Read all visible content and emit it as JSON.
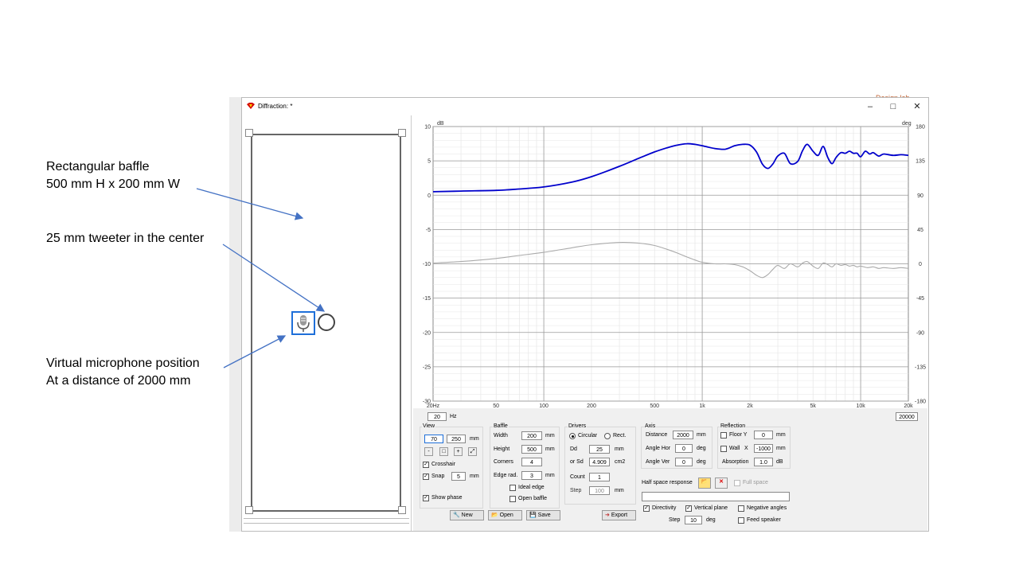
{
  "annotations": {
    "baffle_line1": "Rectangular baffle",
    "baffle_line2": "500 mm H x 200 mm W",
    "tweeter": "25 mm tweeter in the center",
    "mic_line1": "Virtual microphone position",
    "mic_line2": "At a distance of 2000 mm"
  },
  "window": {
    "title": "Diffraction: *",
    "minimize": "–",
    "maximize": "□",
    "close": "✕",
    "peek_text": "Design lab"
  },
  "chart_data": {
    "type": "line",
    "x_scale": "log",
    "xlim": [
      20,
      20000
    ],
    "ylim": [
      -30,
      10
    ],
    "y2lim": [
      -180,
      180
    ],
    "ylabel": "dB",
    "y2label": "deg",
    "x_ticks": [
      {
        "v": 20,
        "label": "20Hz"
      },
      {
        "v": 50,
        "label": "50"
      },
      {
        "v": 100,
        "label": "100"
      },
      {
        "v": 200,
        "label": "200"
      },
      {
        "v": 500,
        "label": "500"
      },
      {
        "v": 1000,
        "label": "1k"
      },
      {
        "v": 2000,
        "label": "2k"
      },
      {
        "v": 5000,
        "label": "5k"
      },
      {
        "v": 10000,
        "label": "10k"
      },
      {
        "v": 20000,
        "label": "20k"
      }
    ],
    "y_ticks": [
      10,
      5,
      0,
      -5,
      -10,
      -15,
      -20,
      -25,
      -30
    ],
    "y2_ticks": [
      180,
      135,
      90,
      45,
      0,
      -45,
      -90,
      -135,
      -180
    ],
    "grid": true,
    "series": [
      {
        "color": "#0000cc",
        "axis": "left",
        "x": [
          20,
          30,
          50,
          70,
          100,
          150,
          200,
          300,
          400,
          500,
          600,
          700,
          800,
          900,
          1000,
          1200,
          1400,
          1600,
          1800,
          2000,
          2200,
          2400,
          2600,
          2800,
          3000,
          3300,
          3600,
          4000,
          4300,
          4600,
          5000,
          5400,
          5800,
          6200,
          6600,
          7000,
          7500,
          8000,
          8500,
          9000,
          9500,
          10000,
          10700,
          11400,
          12000,
          13000,
          14000,
          16000,
          18000,
          20000
        ],
        "y": [
          0.5,
          0.6,
          0.7,
          0.9,
          1.2,
          1.9,
          2.7,
          4.2,
          5.4,
          6.3,
          6.9,
          7.3,
          7.5,
          7.4,
          7.2,
          6.8,
          6.7,
          7.2,
          7.4,
          7.3,
          6.3,
          4.5,
          3.9,
          4.6,
          5.7,
          6.1,
          4.6,
          4.9,
          6.5,
          7.4,
          6.4,
          5.8,
          7.1,
          5.5,
          4.6,
          5.5,
          6.2,
          6.1,
          6.4,
          6.1,
          6.1,
          5.6,
          6.4,
          6.0,
          6.2,
          5.7,
          6.0,
          5.8,
          5.9,
          5.8
        ]
      },
      {
        "color": "#aaaaaa",
        "axis": "right",
        "x": [
          20,
          30,
          50,
          70,
          100,
          150,
          200,
          300,
          400,
          500,
          600,
          700,
          800,
          900,
          1000,
          1200,
          1400,
          1600,
          1800,
          2000,
          2200,
          2400,
          2600,
          2800,
          3000,
          3300,
          3600,
          4000,
          4300,
          4600,
          5000,
          5400,
          5800,
          6200,
          6600,
          7000,
          7500,
          8000,
          8500,
          9000,
          9500,
          10000,
          11000,
          12000,
          13000,
          14000,
          16000,
          18000,
          20000
        ],
        "y": [
          1,
          3,
          7,
          11,
          15,
          21,
          25,
          28,
          27,
          24,
          19,
          14,
          9,
          5,
          2,
          0,
          0,
          -1,
          -4,
          -9,
          -15,
          -18,
          -14,
          -7,
          -2,
          -6,
          0,
          -4,
          1,
          3,
          -3,
          -6,
          1,
          -1,
          -4,
          0,
          -2,
          -1,
          -3,
          -2,
          -4,
          -3,
          -5,
          -4,
          -6,
          -5,
          -6,
          -5,
          -6
        ]
      }
    ]
  },
  "freq": {
    "start": "20",
    "unit": "Hz",
    "end": "20000"
  },
  "view": {
    "title": "View",
    "v1": "70",
    "v2": "250",
    "unit": "mm",
    "crosshair": "Crosshair",
    "snap": "Snap",
    "snap_val": "5",
    "snap_unit": "mm",
    "show_phase": "Show phase"
  },
  "baffle": {
    "title": "Baffle",
    "width_label": "Width",
    "width": "200",
    "height_label": "Height",
    "height": "500",
    "corners_label": "Corners",
    "corners": "4",
    "edge_label": "Edge rad.",
    "edge": "3",
    "unit": "mm",
    "ideal_edge": "Ideal edge",
    "open_baffle": "Open baffle"
  },
  "drivers": {
    "title": "Drivers",
    "circular": "Circular",
    "rect": "Rect.",
    "dd_label": "Dd",
    "dd": "25",
    "dd_unit": "mm",
    "sd_label": "or Sd",
    "sd": "4.909",
    "sd_unit": "cm2",
    "count_label": "Count",
    "count": "1",
    "step_label": "Step",
    "step": "100",
    "step_unit": "mm"
  },
  "axis": {
    "title": "Axis",
    "distance_label": "Distance",
    "distance": "2000",
    "distance_unit": "mm",
    "hor_label": "Angle Hor",
    "hor": "0",
    "hor_unit": "deg",
    "ver_label": "Angle Ver",
    "ver": "0",
    "ver_unit": "deg"
  },
  "reflection": {
    "title": "Reflection",
    "floor_label": "Floor Y",
    "floor": "0",
    "floor_unit": "mm",
    "wall_label": "Wall",
    "wall_axis": "X",
    "wall": "-1000",
    "wall_unit": "mm",
    "absorption_label": "Absorption",
    "absorption": "1.0",
    "absorption_unit": "dB"
  },
  "halfspace": {
    "label": "Half space response",
    "full_space": "Full space",
    "directivity": "Directivity",
    "vertical_plane": "Vertical plane",
    "negative_angles": "Negative angles",
    "step_label": "Step",
    "step": "10",
    "step_unit": "deg",
    "feed_speaker": "Feed speaker"
  },
  "buttons": {
    "new": "New",
    "open": "Open",
    "save": "Save",
    "export": "Export"
  }
}
